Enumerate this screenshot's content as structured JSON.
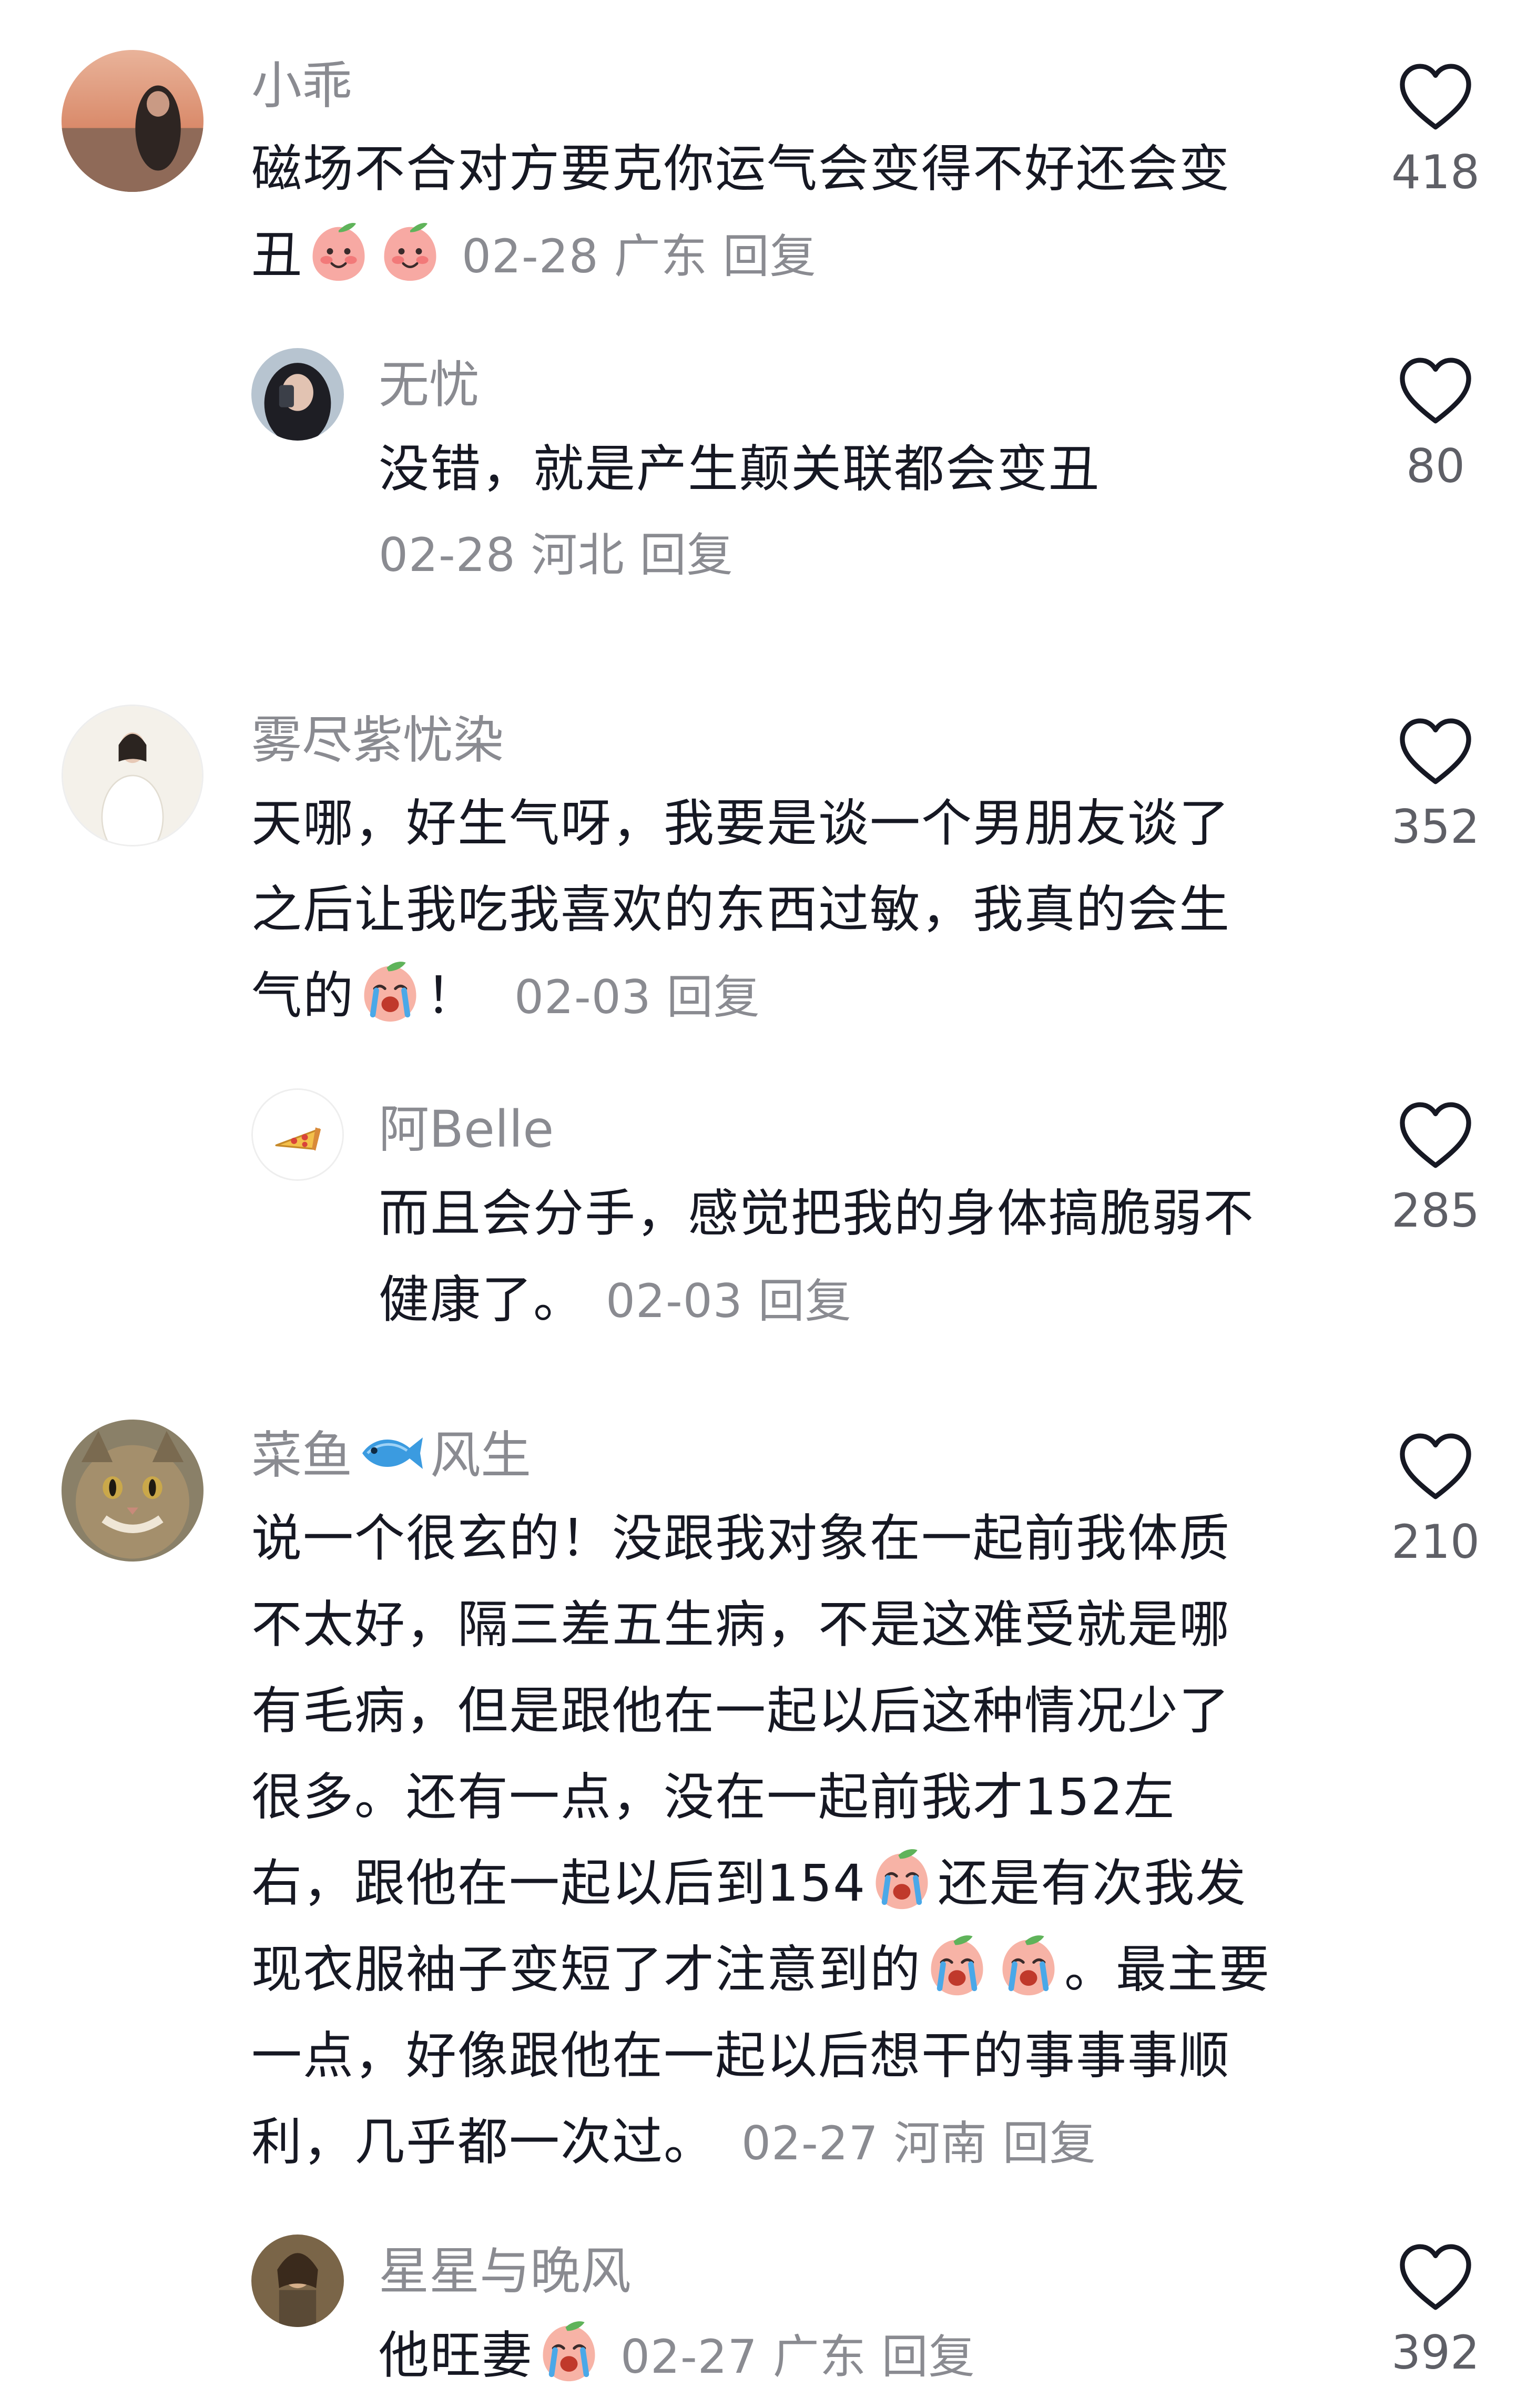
{
  "comments": [
    {
      "user": "小乖",
      "lines": [
        "磁场不合对方要克你运气会变得不好还会变",
        "丑"
      ],
      "date": "02-28",
      "region": "广东",
      "reply_label": "回复",
      "likes": "418"
    },
    {
      "user": "无忧",
      "lines": [
        "没错，就是产生颠关联都会变丑"
      ],
      "date": "02-28",
      "region": "河北",
      "reply_label": "回复",
      "likes": "80"
    },
    {
      "user": "雾尽紫忧染",
      "lines": [
        "天哪，好生气呀，我要是谈一个男朋友谈了",
        "之后让我吃我喜欢的东西过敏，我真的会生",
        "气的",
        "！"
      ],
      "date": "02-03",
      "reply_label": "回复",
      "likes": "352"
    },
    {
      "user": "阿Belle",
      "lines": [
        "而且会分手，感觉把我的身体搞脆弱不",
        "健康了。"
      ],
      "date": "02-03",
      "reply_label": "回复",
      "likes": "285"
    },
    {
      "user_prefix": "菜鱼",
      "user_suffix": "风生",
      "lines": [
        "说一个很玄的！没跟我对象在一起前我体质",
        "不太好，隔三差五生病，不是这难受就是哪",
        "有毛病，但是跟他在一起以后这种情况少了",
        "很多。还有一点，没在一起前我才152左",
        "右，跟他在一起以后到154",
        "还是有次我发",
        "现衣服袖子变短了才注意到的",
        "。最主要",
        "一点，好像跟他在一起以后想干的事事事顺",
        "利，几乎都一次过。"
      ],
      "date": "02-27",
      "region": "河南",
      "reply_label": "回复",
      "likes": "210"
    },
    {
      "user": "星星与晚风",
      "lines": [
        "他旺妻"
      ],
      "date": "02-27",
      "region": "广东",
      "reply_label": "回复",
      "likes": "392"
    }
  ],
  "colors": {
    "text": "#161823",
    "secondary": "#8a8b91",
    "like_count": "#5e5f66",
    "background": "#ffffff"
  },
  "icons": {
    "like": "heart-outline-icon",
    "emoji_peach": "peach-smile-emoji",
    "emoji_cry": "crying-face-emoji",
    "fish": "fish-emoji"
  }
}
